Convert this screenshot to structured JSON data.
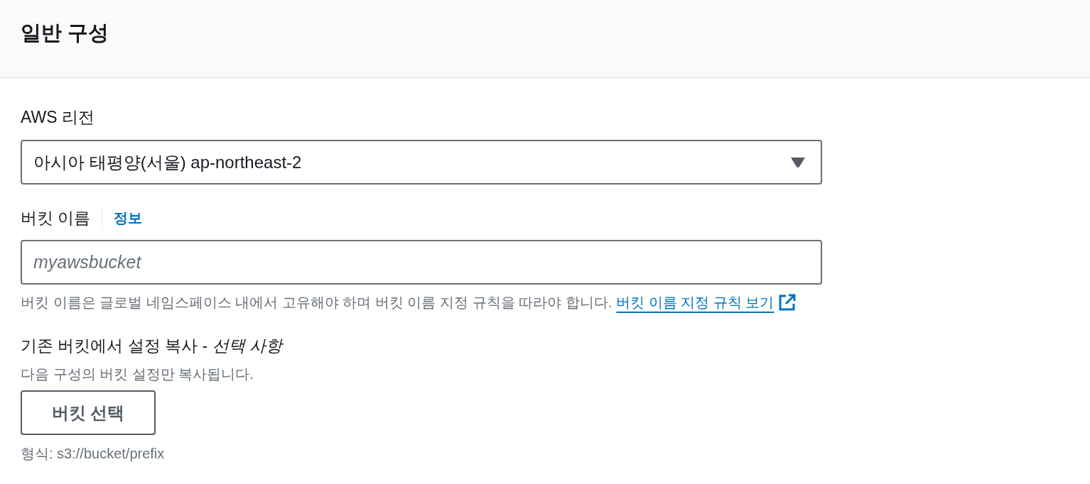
{
  "panel": {
    "title": "일반 구성"
  },
  "fields": [
    {
      "kind": "select",
      "label": "AWS 리전",
      "value": "아시아 태평양(서울) ap-northeast-2"
    },
    {
      "kind": "input",
      "label": "버킷 이름",
      "info": "정보",
      "placeholder": "myawsbucket",
      "hint": "버킷 이름은 글로벌 네임스페이스 내에서 고유해야 하며 버킷 이름 지정 규칙을 따라야 합니다.",
      "hint_link": "버킷 이름 지정 규칙 보기"
    },
    {
      "kind": "button",
      "label": "기존 버킷에서 설정 복사 - *선택 사항*",
      "description": "다음 구성의 버킷 설정만 복사됩니다.",
      "button": "버킷 선택",
      "hint": "형식: s3://bucket/prefix"
    }
  ]
}
